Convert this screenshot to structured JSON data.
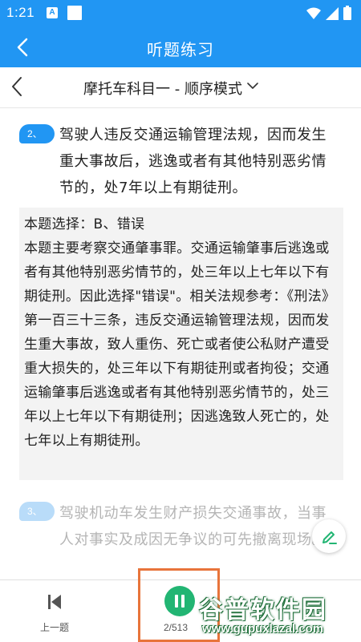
{
  "status_bar": {
    "time": "1:21",
    "notification_icon_letter": "A",
    "icons": [
      "a-notification-icon",
      "square-notification-icon",
      "wifi-icon",
      "cell-signal-icon",
      "battery-icon"
    ]
  },
  "app_bar": {
    "title": "听题练习",
    "background_color": "#2196f3"
  },
  "sub_header": {
    "mode_title": "摩托车科目一 - 顺序模式"
  },
  "questions": [
    {
      "badge": "2、",
      "text": "驾驶人违反交通运输管理法规，因而发生重大事故后，逃逸或者有其他特别恶劣情节的，处7年以上有期徒刑。",
      "explanation": {
        "choice": "本题选择：B、错误",
        "body": "本题主要考察交通肇事罪。交通运输肇事后逃逸或者有其他特别恶劣情节的，处三年以上七年以下有期徒刑。因此选择\"错误\"。相关法规参考：《刑法》第一百三十三条，违反交通运输管理法规，因而发生重大事故，致人重伤、死亡或者使公私财产遭受重大损失的，处三年以下有期徒刑或者拘役；交通运输肇事后逃逸或者有其他特别恶劣情节的，处三年以上七年以下有期徒刑；因逃逸致人死亡的，处七年以上有期徒刑。"
      }
    },
    {
      "badge": "3、",
      "text": "驾驶机动车发生财产损失交通事故，当事人对事实及成因无争议的可先撤离现场。"
    }
  ],
  "bottom_bar": {
    "prev_label": "上一题",
    "progress": "2/513",
    "play_state": "playing",
    "accent_color": "#22b573"
  },
  "watermark": {
    "logo_text": "谷普软件园",
    "url": "www.gupuxlazal.com"
  }
}
